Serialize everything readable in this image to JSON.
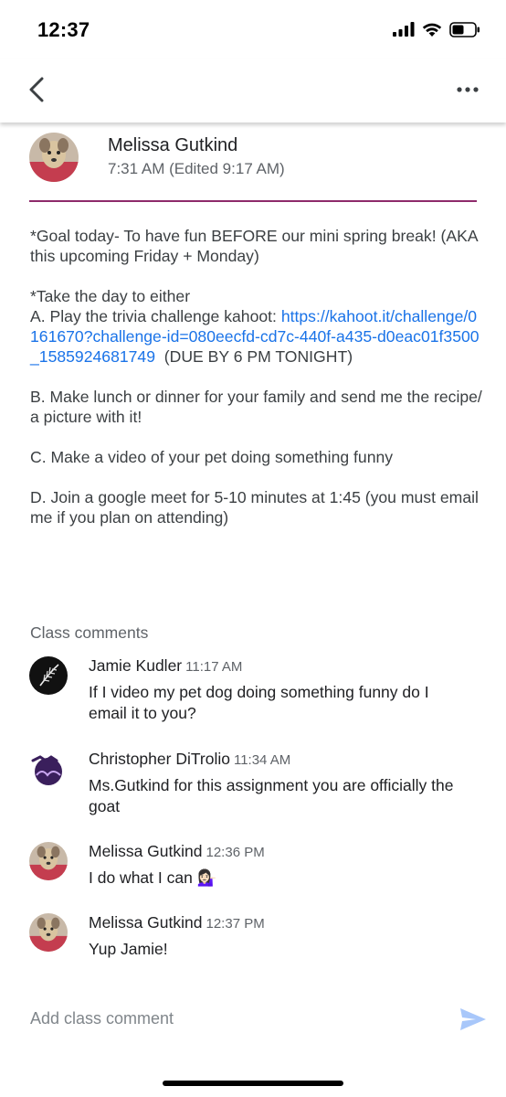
{
  "status_bar": {
    "time": "12:37",
    "icons": [
      "signal-icon",
      "wifi-icon",
      "battery-icon"
    ]
  },
  "app_bar": {
    "icons": [
      "back-arrow-icon",
      "more-options-icon"
    ]
  },
  "post": {
    "author": "Melissa Gutkind",
    "time": "7:31 AM (Edited 9:17 AM)",
    "body": {
      "goal": "*Goal today- To have fun BEFORE our mini spring break! (AKA this upcoming Friday + Monday)",
      "take_day": "*Take the day to either",
      "option_a_prefix": "A. Play the trivia challenge kahoot: ",
      "option_a_link": "https://kahoot.it/challenge/0161670?challenge-id=080eecfd-cd7c-440f-a435-d0eac01f3500_1585924681749",
      "option_a_suffix": "  (DUE BY 6 PM TONIGHT)",
      "option_b": "B. Make lunch or dinner for your family and send me the recipe/ a picture with it!",
      "option_c": "C. Make a video of your pet doing something funny",
      "option_d": "D. Join a google meet for 5-10 minutes at 1:45 (you must email me if you plan on attending)"
    },
    "divider_color": "#8e2a6b",
    "link_color": "#1a73e8"
  },
  "comments_section": {
    "title": "Class comments",
    "comments": [
      {
        "author": "Jamie Kudler",
        "time": "11:17 AM",
        "text": "If I video my pet dog doing something funny do I email it to you?"
      },
      {
        "author": "Christopher DiTrolio",
        "time": "11:34 AM",
        "text": "Ms.Gutkind for this assignment you are officially the goat"
      },
      {
        "author": "Melissa Gutkind",
        "time": "12:36 PM",
        "text": "I do what I can 💁🏻‍♀️"
      },
      {
        "author": "Melissa Gutkind",
        "time": "12:37 PM",
        "text": "Yup Jamie!"
      }
    ]
  },
  "composer": {
    "placeholder": "Add class comment",
    "send_icon": "send-icon",
    "send_color": "#a8c7fa"
  }
}
